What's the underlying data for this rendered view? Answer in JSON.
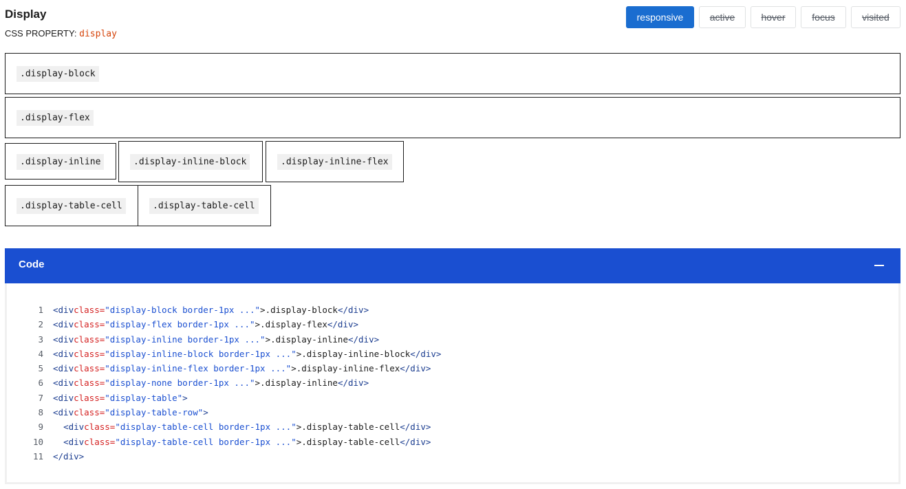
{
  "header": {
    "title": "Display",
    "property_label": "CSS PROPERTY:",
    "property_value": "display"
  },
  "variants": [
    {
      "label": "responsive",
      "active": true
    },
    {
      "label": "active",
      "active": false
    },
    {
      "label": "hover",
      "active": false
    },
    {
      "label": "focus",
      "active": false
    },
    {
      "label": "visited",
      "active": false
    }
  ],
  "demos": {
    "block": ".display-block",
    "flex": ".display-flex",
    "inline": ".display-inline",
    "inline_block": ".display-inline-block",
    "inline_flex": ".display-inline-flex",
    "table_cell_1": ".display-table-cell",
    "table_cell_2": ".display-table-cell"
  },
  "code": {
    "label": "Code",
    "collapse_icon": "minus-icon",
    "lines": [
      {
        "n": "1",
        "indent": "",
        "open": "<div",
        "attr": "class=",
        "str": "\"display-block border-1px ...\"",
        "text": ">.display-block",
        "close": "</div>"
      },
      {
        "n": "2",
        "indent": "",
        "open": "<div",
        "attr": "class=",
        "str": "\"display-flex border-1px ...\"",
        "text": ">.display-flex",
        "close": "</div>"
      },
      {
        "n": "3",
        "indent": "",
        "open": "<div",
        "attr": "class=",
        "str": "\"display-inline border-1px ...\"",
        "text": ">.display-inline",
        "close": "</div>"
      },
      {
        "n": "4",
        "indent": "",
        "open": "<div",
        "attr": "class=",
        "str": "\"display-inline-block border-1px ...\"",
        "text": ">.display-inline-block",
        "close": "</div>"
      },
      {
        "n": "5",
        "indent": "",
        "open": "<div",
        "attr": "class=",
        "str": "\"display-inline-flex border-1px ...\"",
        "text": ">.display-inline-flex",
        "close": "</div>"
      },
      {
        "n": "6",
        "indent": "",
        "open": "<div",
        "attr": "class=",
        "str": "\"display-none border-1px ...\"",
        "text": ">.display-inline",
        "close": "</div>"
      },
      {
        "n": "7",
        "indent": "",
        "open": "<div",
        "attr": "class=",
        "str": "\"display-table\"",
        "text": ">",
        "close": ""
      },
      {
        "n": "8",
        "indent": "",
        "open": "<div",
        "attr": "class=",
        "str": "\"display-table-row\"",
        "text": ">",
        "close": ""
      },
      {
        "n": "9",
        "indent": "  ",
        "open": "<div",
        "attr": "class=",
        "str": "\"display-table-cell border-1px ...\"",
        "text": ">.display-table-cell",
        "close": "</div>"
      },
      {
        "n": "10",
        "indent": "  ",
        "open": "<div",
        "attr": "class=",
        "str": "\"display-table-cell border-1px ...\"",
        "text": ">.display-table-cell",
        "close": "</div>"
      },
      {
        "n": "11",
        "indent": "",
        "open": "</div>",
        "attr": "",
        "str": "",
        "text": "",
        "close": ""
      }
    ]
  },
  "colors": {
    "primary": "#1a6dd0",
    "code_header": "#1a4fd1",
    "property_value": "#d54309"
  }
}
